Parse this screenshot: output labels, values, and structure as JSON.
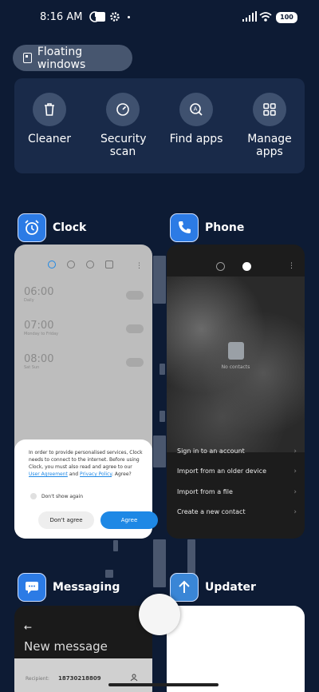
{
  "status_bar": {
    "time": "8:16 AM",
    "battery": "100"
  },
  "floating_windows": {
    "label": "Floating windows"
  },
  "quick_actions": [
    {
      "label": "Cleaner",
      "icon": "trash-icon"
    },
    {
      "label": "Security scan",
      "icon": "shield-gauge-icon"
    },
    {
      "label": "Find apps",
      "icon": "search-app-icon"
    },
    {
      "label": "Manage apps",
      "icon": "grid-icon"
    }
  ],
  "apps": {
    "clock": {
      "name": "Clock",
      "icon_color": "#2c7be5",
      "alarms": [
        {
          "time": "06:00",
          "sub": "Daily"
        },
        {
          "time": "07:00",
          "sub": "Monday to Friday"
        },
        {
          "time": "08:00",
          "sub": "Sat Sun"
        }
      ],
      "dialog": {
        "message_start": "In order to provide personalised services, Clock needs to connect to the internet. Before using Clock, you must also read and agree to our ",
        "link_user_agreement": "User Agreement",
        "and": " and ",
        "link_privacy": "Privacy Policy",
        "message_end": ". Agree?",
        "checkbox": "Don't show again",
        "disagree": "Don't agree",
        "agree": "Agree"
      }
    },
    "phone": {
      "name": "Phone",
      "icon_color": "#2c7be5",
      "empty": "No contacts",
      "items": [
        "Sign in to an account",
        "Import from an older device",
        "Import from a file",
        "Create a new contact"
      ]
    },
    "messaging": {
      "name": "Messaging",
      "icon_color": "#2c7be5",
      "title": "New message",
      "recipient_label": "Recipient:",
      "recipient_number": "18730218809"
    },
    "updater": {
      "name": "Updater",
      "icon_color": "#3a86d6"
    }
  }
}
